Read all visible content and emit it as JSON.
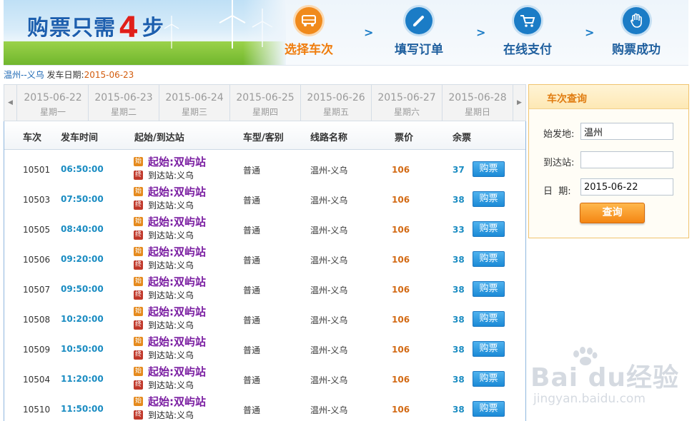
{
  "banner": {
    "title_prefix": "购票只需",
    "title_number": "4",
    "title_suffix": "步",
    "steps": [
      {
        "label": "选择车次",
        "icon": "bus-icon",
        "state": "active"
      },
      {
        "label": "填写订单",
        "icon": "pencil-icon",
        "state": "todo"
      },
      {
        "label": "在线支付",
        "icon": "cart-icon",
        "state": "todo"
      },
      {
        "label": "购票成功",
        "icon": "hand-icon",
        "state": "todo"
      }
    ],
    "step_separator": ">"
  },
  "route": {
    "from": "温州",
    "separator": "--",
    "to": "义乌",
    "date_label": "发车日期:",
    "date": "2015-06-23"
  },
  "datebar": {
    "prev_icon": "triangle-left-icon",
    "next_icon": "triangle-right-icon",
    "dates": [
      {
        "date": "2015-06-22",
        "weekday": "星期一"
      },
      {
        "date": "2015-06-23",
        "weekday": "星期二"
      },
      {
        "date": "2015-06-24",
        "weekday": "星期三"
      },
      {
        "date": "2015-06-25",
        "weekday": "星期四"
      },
      {
        "date": "2015-06-26",
        "weekday": "星期五"
      },
      {
        "date": "2015-06-27",
        "weekday": "星期六"
      },
      {
        "date": "2015-06-28",
        "weekday": "星期日"
      }
    ]
  },
  "table": {
    "headers": [
      "车次",
      "发车时间",
      "起始/到达站",
      "车型/客别",
      "线路名称",
      "票价",
      "余票"
    ],
    "start_tag": "始",
    "end_tag": "终",
    "rows": [
      {
        "no": "10501",
        "time": "06:50:00",
        "start": "起始:双屿站",
        "end": "到达站:义乌",
        "type": "普通",
        "line": "温州-义乌",
        "price": "106",
        "left": "37",
        "buy": "购票"
      },
      {
        "no": "10503",
        "time": "07:50:00",
        "start": "起始:双屿站",
        "end": "到达站:义乌",
        "type": "普通",
        "line": "温州-义乌",
        "price": "106",
        "left": "38",
        "buy": "购票"
      },
      {
        "no": "10505",
        "time": "08:40:00",
        "start": "起始:双屿站",
        "end": "到达站:义乌",
        "type": "普通",
        "line": "温州-义乌",
        "price": "106",
        "left": "33",
        "buy": "购票"
      },
      {
        "no": "10506",
        "time": "09:20:00",
        "start": "起始:双屿站",
        "end": "到达站:义乌",
        "type": "普通",
        "line": "温州-义乌",
        "price": "106",
        "left": "38",
        "buy": "购票"
      },
      {
        "no": "10507",
        "time": "09:50:00",
        "start": "起始:双屿站",
        "end": "到达站:义乌",
        "type": "普通",
        "line": "温州-义乌",
        "price": "106",
        "left": "38",
        "buy": "购票"
      },
      {
        "no": "10508",
        "time": "10:20:00",
        "start": "起始:双屿站",
        "end": "到达站:义乌",
        "type": "普通",
        "line": "温州-义乌",
        "price": "106",
        "left": "38",
        "buy": "购票"
      },
      {
        "no": "10509",
        "time": "10:50:00",
        "start": "起始:双屿站",
        "end": "到达站:义乌",
        "type": "普通",
        "line": "温州-义乌",
        "price": "106",
        "left": "38",
        "buy": "购票"
      },
      {
        "no": "10504",
        "time": "11:20:00",
        "start": "起始:双屿站",
        "end": "到达站:义乌",
        "type": "普通",
        "line": "温州-义乌",
        "price": "106",
        "left": "38",
        "buy": "购票"
      },
      {
        "no": "10510",
        "time": "11:50:00",
        "start": "起始:双屿站",
        "end": "到达站:义乌",
        "type": "普通",
        "line": "温州-义乌",
        "price": "106",
        "left": "38",
        "buy": "购票"
      }
    ]
  },
  "search_panel": {
    "title": "车次查询",
    "from_label": "始发地:",
    "from_value": "温州",
    "to_label": "到达站:",
    "to_value": "",
    "date_label": "日  期:",
    "date_value": "2015-06-22",
    "submit_label": "查询"
  },
  "watermark": {
    "logo": "Bai  du经验",
    "url": "jingyan.baidu.com"
  },
  "colors": {
    "active_step": "#ef7d0e",
    "step_blue": "#1b7cc6",
    "time": "#1a8cc2",
    "price": "#d36a14",
    "start_station": "#7b1fa2"
  }
}
